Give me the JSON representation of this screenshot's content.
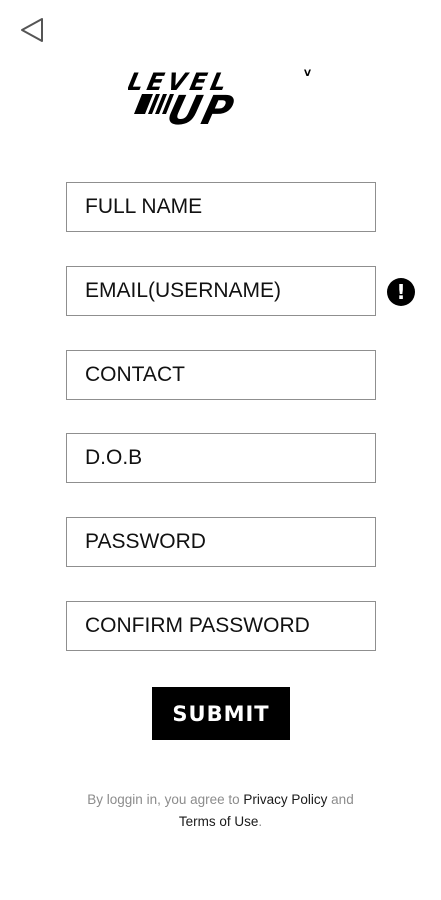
{
  "nav": {
    "back_icon": "back-triangle-icon"
  },
  "brand": {
    "logo_text_top": "LEVEL",
    "logo_text_bottom": "UP",
    "logo_superscript": "V"
  },
  "form": {
    "full_name_placeholder": "FULL NAME",
    "email_placeholder": "EMAIL(USERNAME)",
    "contact_placeholder": "CONTACT",
    "dob_placeholder": "D.O.B",
    "password_placeholder": "PASSWORD",
    "confirm_password_placeholder": "CONFIRM PASSWORD",
    "email_alert_icon": "exclamation-icon",
    "email_alert_glyph": "!",
    "submit_label": "SUBMIT"
  },
  "legal": {
    "prefix": "By loggin in, you agree to ",
    "privacy_link": "Privacy Policy",
    "middle": " and ",
    "terms_link": "Terms of Use",
    "suffix": "."
  },
  "colors": {
    "background": "#ffffff",
    "field_border": "#8f8f8f",
    "button_bg": "#000000",
    "button_text": "#ffffff",
    "legal_text": "#8c8c8c"
  }
}
